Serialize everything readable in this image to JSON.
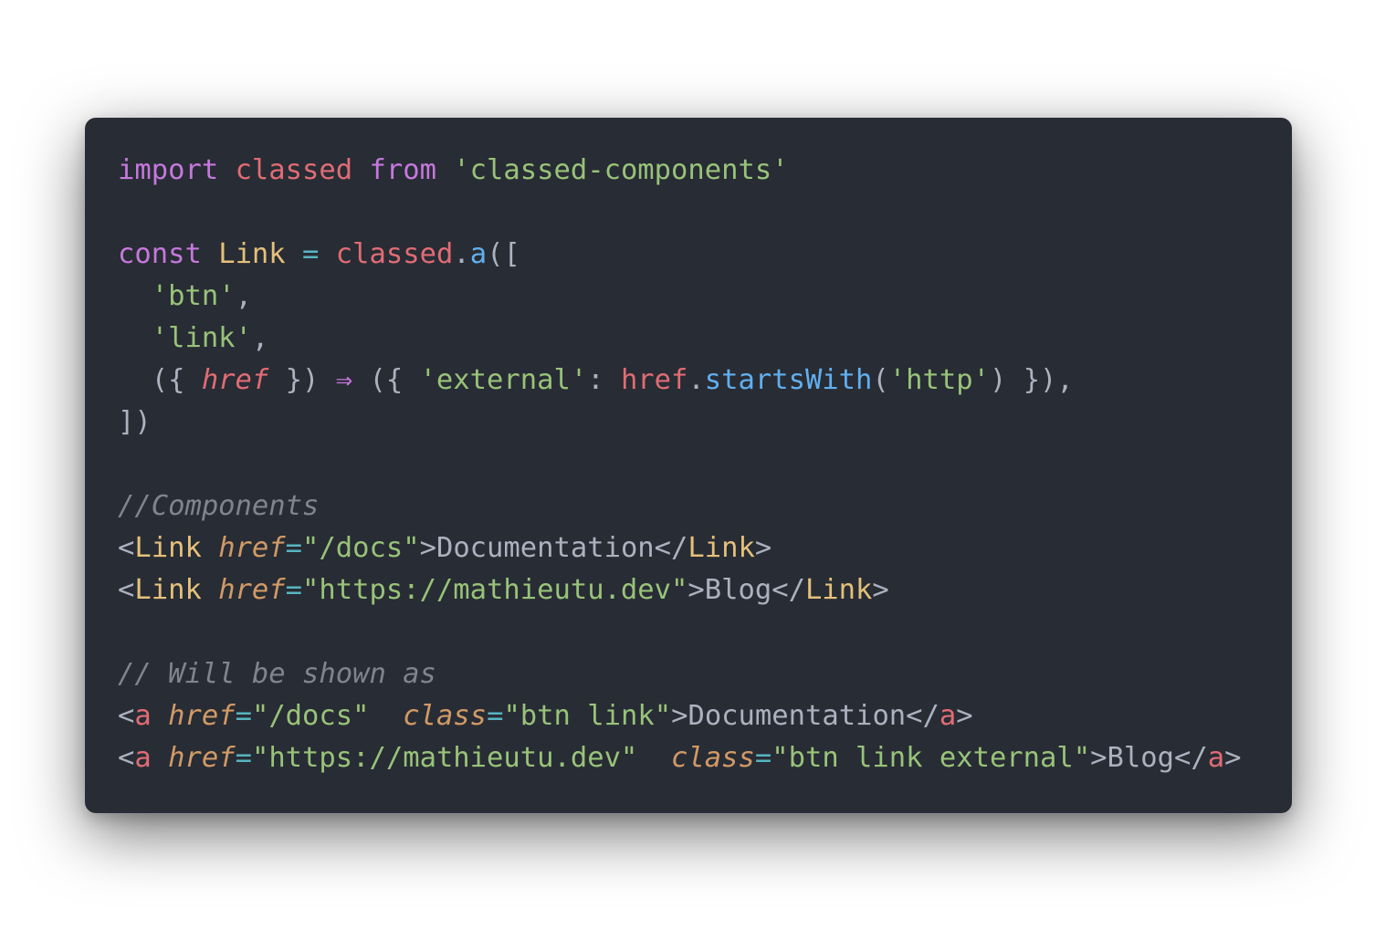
{
  "colors": {
    "page_background": "#ffffff",
    "editor_background": "#282c34",
    "keyword": "#c678dd",
    "variable": "#e06c75",
    "string": "#98c379",
    "class_name": "#e5c07b",
    "punctuation": "#abb2bf",
    "operator": "#56b6c2",
    "function": "#61afef",
    "comment": "#7f848e",
    "attribute": "#d19a66"
  },
  "code": {
    "lines": [
      [
        {
          "t": "import",
          "c": "kw"
        },
        {
          "t": " ",
          "c": "punc"
        },
        {
          "t": "classed",
          "c": "var"
        },
        {
          "t": " ",
          "c": "punc"
        },
        {
          "t": "from",
          "c": "kw"
        },
        {
          "t": " ",
          "c": "punc"
        },
        {
          "t": "'classed-components'",
          "c": "str"
        }
      ],
      [],
      [
        {
          "t": "const",
          "c": "kw"
        },
        {
          "t": " ",
          "c": "punc"
        },
        {
          "t": "Link",
          "c": "cls"
        },
        {
          "t": " ",
          "c": "punc"
        },
        {
          "t": "=",
          "c": "op"
        },
        {
          "t": " ",
          "c": "punc"
        },
        {
          "t": "classed",
          "c": "var"
        },
        {
          "t": ".",
          "c": "punc"
        },
        {
          "t": "a",
          "c": "fn"
        },
        {
          "t": "([",
          "c": "punc"
        }
      ],
      [
        {
          "t": "  ",
          "c": "punc"
        },
        {
          "t": "'btn'",
          "c": "str"
        },
        {
          "t": ",",
          "c": "punc"
        }
      ],
      [
        {
          "t": "  ",
          "c": "punc"
        },
        {
          "t": "'link'",
          "c": "str"
        },
        {
          "t": ",",
          "c": "punc"
        }
      ],
      [
        {
          "t": "  ({ ",
          "c": "punc"
        },
        {
          "t": "href",
          "c": "param"
        },
        {
          "t": " }) ",
          "c": "punc"
        },
        {
          "t": "⇒",
          "c": "arrow"
        },
        {
          "t": " ({ ",
          "c": "punc"
        },
        {
          "t": "'external'",
          "c": "str"
        },
        {
          "t": ": ",
          "c": "punc"
        },
        {
          "t": "href",
          "c": "var"
        },
        {
          "t": ".",
          "c": "punc"
        },
        {
          "t": "startsWith",
          "c": "fn"
        },
        {
          "t": "(",
          "c": "punc"
        },
        {
          "t": "'http'",
          "c": "str"
        },
        {
          "t": ") }),",
          "c": "punc"
        }
      ],
      [
        {
          "t": "])",
          "c": "punc"
        }
      ],
      [],
      [
        {
          "t": "//Components",
          "c": "cmt"
        }
      ],
      [
        {
          "t": "<",
          "c": "punc"
        },
        {
          "t": "Link",
          "c": "jsx"
        },
        {
          "t": " ",
          "c": "punc"
        },
        {
          "t": "href",
          "c": "attr"
        },
        {
          "t": "=",
          "c": "op"
        },
        {
          "t": "\"/docs\"",
          "c": "str"
        },
        {
          "t": ">",
          "c": "punc"
        },
        {
          "t": "Documentation",
          "c": "txt"
        },
        {
          "t": "</",
          "c": "punc"
        },
        {
          "t": "Link",
          "c": "jsx"
        },
        {
          "t": ">",
          "c": "punc"
        }
      ],
      [
        {
          "t": "<",
          "c": "punc"
        },
        {
          "t": "Link",
          "c": "jsx"
        },
        {
          "t": " ",
          "c": "punc"
        },
        {
          "t": "href",
          "c": "attr"
        },
        {
          "t": "=",
          "c": "op"
        },
        {
          "t": "\"https://mathieutu.dev\"",
          "c": "str"
        },
        {
          "t": ">",
          "c": "punc"
        },
        {
          "t": "Blog",
          "c": "txt"
        },
        {
          "t": "</",
          "c": "punc"
        },
        {
          "t": "Link",
          "c": "jsx"
        },
        {
          "t": ">",
          "c": "punc"
        }
      ],
      [],
      [
        {
          "t": "// Will be shown as",
          "c": "cmt"
        }
      ],
      [
        {
          "t": "<",
          "c": "punc"
        },
        {
          "t": "a",
          "c": "tag"
        },
        {
          "t": " ",
          "c": "punc"
        },
        {
          "t": "href",
          "c": "attr"
        },
        {
          "t": "=",
          "c": "op"
        },
        {
          "t": "\"/docs\"",
          "c": "str"
        },
        {
          "t": "  ",
          "c": "punc"
        },
        {
          "t": "class",
          "c": "attr"
        },
        {
          "t": "=",
          "c": "op"
        },
        {
          "t": "\"btn link\"",
          "c": "str"
        },
        {
          "t": ">",
          "c": "punc"
        },
        {
          "t": "Documentation",
          "c": "txt"
        },
        {
          "t": "</",
          "c": "punc"
        },
        {
          "t": "a",
          "c": "tag"
        },
        {
          "t": ">",
          "c": "punc"
        }
      ],
      [
        {
          "t": "<",
          "c": "punc"
        },
        {
          "t": "a",
          "c": "tag"
        },
        {
          "t": " ",
          "c": "punc"
        },
        {
          "t": "href",
          "c": "attr"
        },
        {
          "t": "=",
          "c": "op"
        },
        {
          "t": "\"https://mathieutu.dev\"",
          "c": "str"
        },
        {
          "t": "  ",
          "c": "punc"
        },
        {
          "t": "class",
          "c": "attr"
        },
        {
          "t": "=",
          "c": "op"
        },
        {
          "t": "\"btn link external\"",
          "c": "str"
        },
        {
          "t": ">",
          "c": "punc"
        },
        {
          "t": "Blog",
          "c": "txt"
        },
        {
          "t": "</",
          "c": "punc"
        },
        {
          "t": "a",
          "c": "tag"
        },
        {
          "t": ">",
          "c": "punc"
        }
      ]
    ]
  }
}
